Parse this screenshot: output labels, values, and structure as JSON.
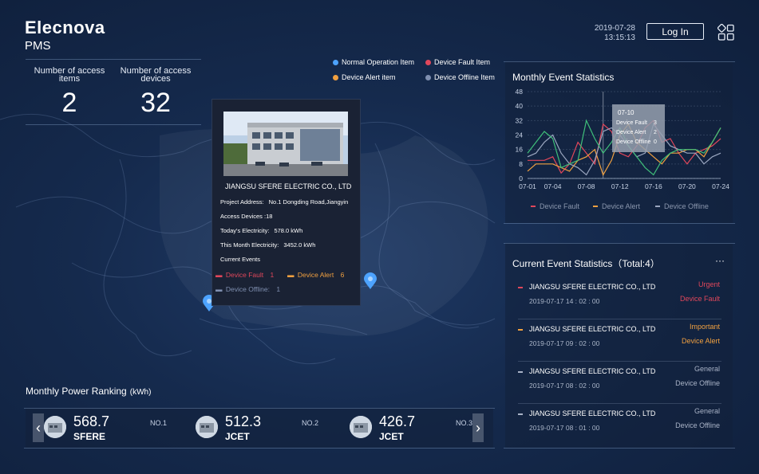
{
  "header": {
    "brand": "Elecnova",
    "subtitle": "PMS",
    "date": "2019-07-28",
    "time": "13:15:13",
    "login_label": "Log In",
    "menu_icon": "grid-apps-icon"
  },
  "stats": {
    "items": [
      {
        "label": "Number of access items",
        "value": "2"
      },
      {
        "label": "Number of access devices",
        "value": "32"
      }
    ]
  },
  "map_legend": [
    {
      "label": "Normal Operation Item",
      "color": "#4da3ff"
    },
    {
      "label": "Device Fault Item",
      "color": "#e0475b"
    },
    {
      "label": "Device Alert item",
      "color": "#f0a040"
    },
    {
      "label": "Device Offline Item",
      "color": "#7f8fb0"
    }
  ],
  "popup": {
    "company": "JIANGSU SFERE ELECTRIC CO., LTD",
    "address_label": "Project Address:",
    "address": "No.1 Dongding Road,Jiangyin",
    "access_devices": "Access Devices :18",
    "today_label": "Today's Electricity:",
    "today_value": "578.0  kWh",
    "month_label": "This Month Electricity:",
    "month_value": "3452.0  kWh",
    "events_label": "Current Events",
    "fault_label": "Device Fault",
    "fault_count": "1",
    "alert_label": "Device Alert",
    "alert_count": "6",
    "offline_label": "Device Offline:",
    "offline_count": "1"
  },
  "monthly_events": {
    "title": "Monthly Event Statistics",
    "tooltip": {
      "date": "07-10",
      "rows": [
        {
          "label": "Device Fault",
          "value": "3"
        },
        {
          "label": "Device Alert",
          "value": "2"
        },
        {
          "label": "Device Offline",
          "value": "0"
        }
      ]
    }
  },
  "chart_data": {
    "type": "line",
    "title": "Monthly Event Statistics",
    "x": [
      "07-01",
      "07-02",
      "07-03",
      "07-04",
      "07-05",
      "07-06",
      "07-07",
      "07-08",
      "07-09",
      "07-10",
      "07-11",
      "07-12",
      "07-13",
      "07-14",
      "07-15",
      "07-16",
      "07-17",
      "07-18",
      "07-19",
      "07-20",
      "07-21",
      "07-22",
      "07-23",
      "07-24"
    ],
    "x_ticks": [
      "07-01",
      "07-04",
      "07-08",
      "07-12",
      "07-16",
      "07-20",
      "07-24"
    ],
    "y_ticks": [
      0,
      8,
      16,
      24,
      32,
      40,
      48
    ],
    "ylim": [
      0,
      48
    ],
    "legend_position": "bottom",
    "series": [
      {
        "name": "Device Fault",
        "color": "#e0475b",
        "values": [
          10,
          10,
          10,
          12,
          3,
          8,
          20,
          14,
          8,
          30,
          26,
          14,
          12,
          18,
          28,
          32,
          20,
          22,
          14,
          8,
          14,
          16,
          18,
          22
        ]
      },
      {
        "name": "Device Alert",
        "color": "#f0a040",
        "values": [
          4,
          8,
          8,
          8,
          6,
          4,
          10,
          12,
          16,
          2,
          10,
          24,
          30,
          20,
          16,
          12,
          8,
          14,
          14,
          16,
          16,
          12,
          20,
          28
        ]
      },
      {
        "name": "Device Offline",
        "color": "#9aa6bf",
        "values": [
          12,
          14,
          20,
          24,
          14,
          8,
          6,
          2,
          10,
          26,
          28,
          24,
          18,
          12,
          14,
          30,
          24,
          18,
          16,
          14,
          14,
          8,
          12,
          14
        ]
      },
      {
        "name": "",
        "color": "#3fbf7a",
        "values": [
          14,
          20,
          26,
          22,
          6,
          8,
          10,
          32,
          22,
          14,
          20,
          28,
          18,
          12,
          6,
          2,
          10,
          14,
          16,
          16,
          16,
          14,
          20,
          28
        ]
      }
    ]
  },
  "current_events": {
    "title": "Current Event Statistics",
    "total": "（Total:4）",
    "more": "···",
    "items": [
      {
        "company": "JIANGSU SFERE ELECTRIC CO., LTD",
        "time": "2019-07-17  14 : 02 : 00",
        "level": "Urgent",
        "type": "Device Fault",
        "color": "#e0475b"
      },
      {
        "company": "JIANGSU SFERE ELECTRIC CO., LTD",
        "time": "2019-07-17  09 : 02 : 00",
        "level": "Important",
        "type": "Device Alert",
        "color": "#f0a040"
      },
      {
        "company": "JIANGSU SFERE ELECTRIC CO., LTD",
        "time": "2019-07-17  08 : 02 : 00",
        "level": "General",
        "type": "Device Offline",
        "color": "#a9b3c7"
      },
      {
        "company": "JIANGSU SFERE ELECTRIC CO., LTD",
        "time": "2019-07-17  08 : 01 : 00",
        "level": "General",
        "type": "Device Offline",
        "color": "#a9b3c7"
      }
    ]
  },
  "ranking": {
    "title": "Monthly Power Ranking",
    "unit": "(kWh)",
    "prev_icon": "chevron-left-icon",
    "next_icon": "chevron-right-icon",
    "items": [
      {
        "value": "568.7",
        "name": "SFERE",
        "rank": "NO.1"
      },
      {
        "value": "512.3",
        "name": "JCET",
        "rank": "NO.2"
      },
      {
        "value": "426.7",
        "name": "JCET",
        "rank": "NO.3"
      }
    ]
  }
}
